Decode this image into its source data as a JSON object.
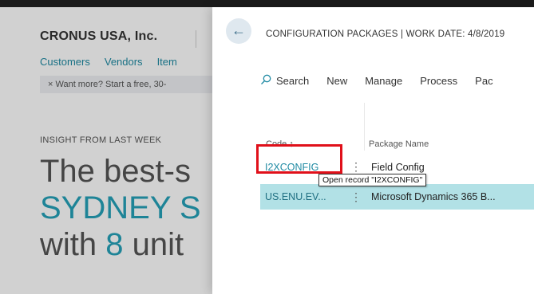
{
  "colors": {
    "accent": "#1f8aa3",
    "selected_row": "#b2e1e6",
    "highlight_box": "#e0101a",
    "top_bar": "#1b1b1b"
  },
  "background": {
    "company": "CRONUS USA, Inc.",
    "nav": [
      "Customers",
      "Vendors",
      "Item"
    ],
    "banner": "× Want more? Start a free, 30-",
    "insight_label": "INSIGHT FROM LAST WEEK",
    "headline_line1": "The best-s",
    "headline_line2": "SYDNEY S",
    "headline_line3_pre": "with ",
    "headline_line3_num": "8",
    "headline_line3_post": " unit"
  },
  "panel": {
    "back_icon": "back-arrow-icon",
    "title": "CONFIGURATION PACKAGES | WORK DATE: 4/8/2019",
    "toolbar": {
      "search": "Search",
      "new": "New",
      "manage": "Manage",
      "process": "Process",
      "more": "Pac"
    },
    "columns": {
      "code": "Code ↑",
      "name": "Package Name"
    },
    "rows": [
      {
        "code": "I2XCONFIG",
        "name": "Field Config"
      },
      {
        "code": "US.ENU.EV...",
        "name": "Microsoft Dynamics 365 B..."
      }
    ],
    "tooltip": "Open record \"I2XCONFIG\""
  }
}
